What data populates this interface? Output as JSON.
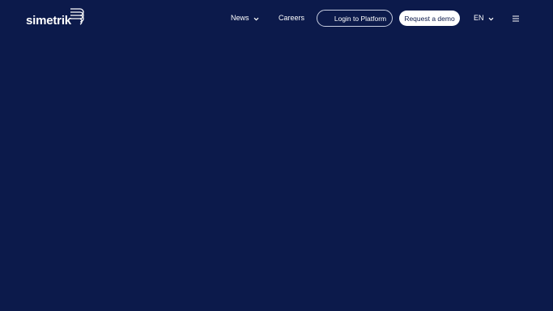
{
  "brand": {
    "logo_text": "simetrik",
    "logo_icon": "simetrik-stack-icon"
  },
  "nav": {
    "news_label": "News",
    "careers_label": "Careers",
    "login_label": "Login to Platform",
    "demo_label": "Request a demo",
    "language_label": "EN",
    "menu_icon": "hamburger-icon",
    "dropdown_icon": "chevron-down-icon"
  },
  "colors": {
    "background": "#0c1a4b",
    "text": "#ffffff",
    "demo_button_bg": "#ffffff",
    "demo_button_text": "#0c1a4b",
    "login_border": "#c7cde0"
  }
}
